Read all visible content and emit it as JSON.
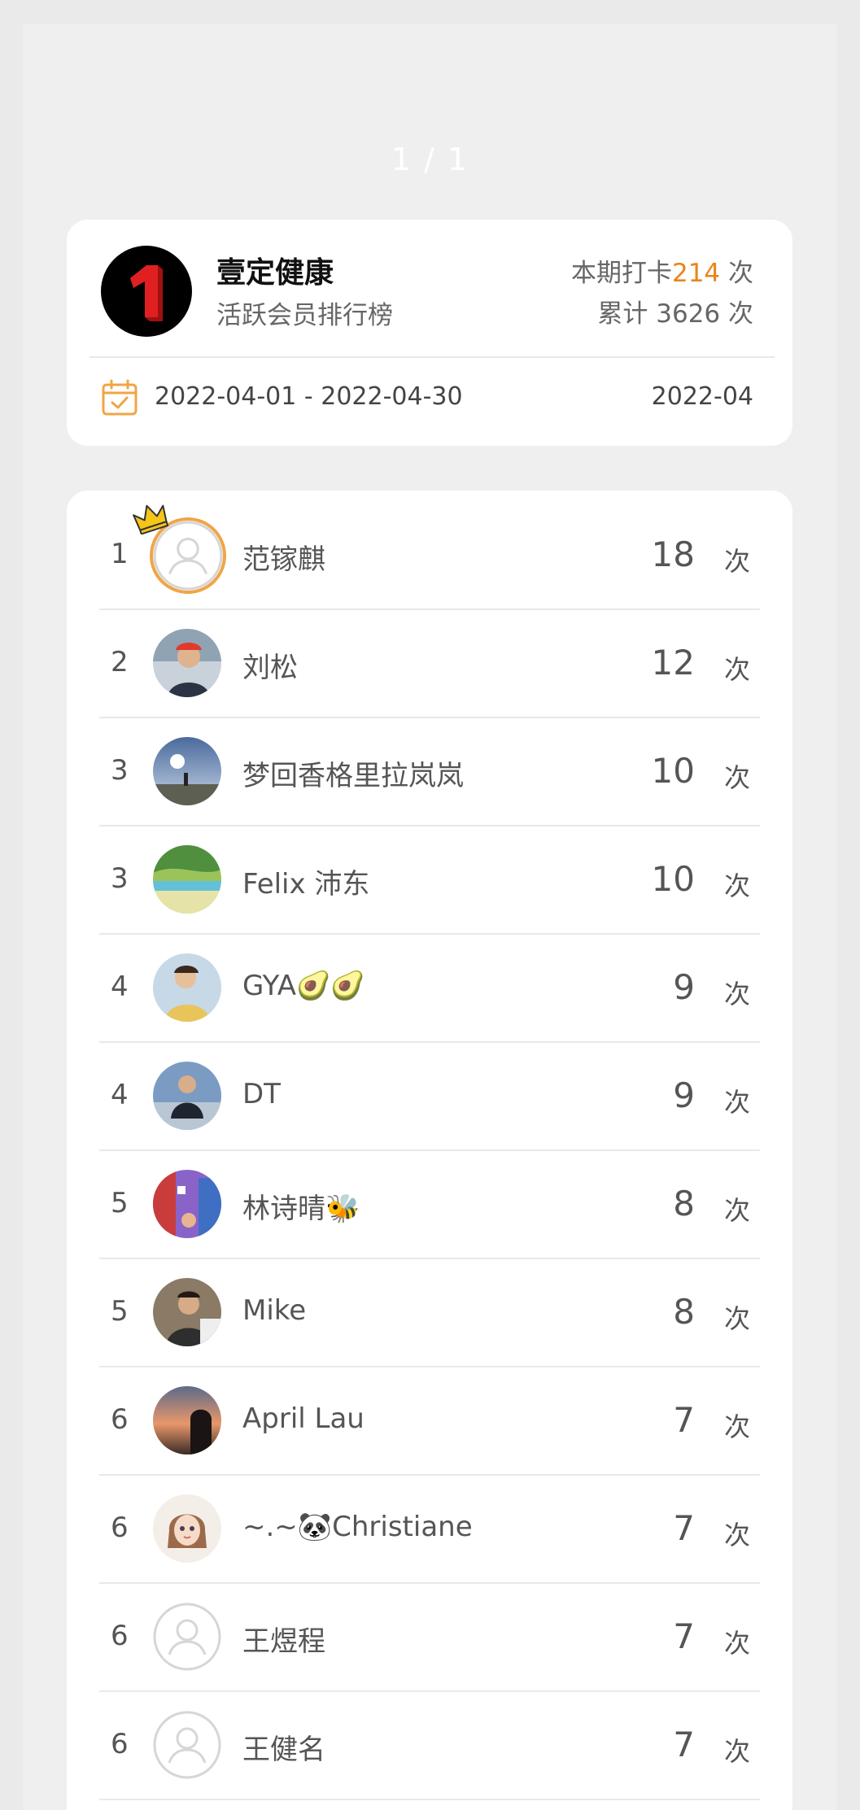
{
  "page_indicator": "1 / 1",
  "header": {
    "org_name": "壹定健康",
    "org_subtitle": "活跃会员排行榜",
    "period_checkins_label": "本期打卡",
    "period_checkins_value": "214",
    "period_checkins_unit": "次",
    "total_line": "累计 3626 次",
    "date_range": "2022-04-01 - 2022-04-30",
    "period": "2022-04",
    "accent_color": "#e8841a",
    "calendar_icon": "calendar-check-icon"
  },
  "unit": "次",
  "ranking": [
    {
      "rank": "1",
      "name": "范镓麒",
      "count": "18"
    },
    {
      "rank": "2",
      "name": "刘松",
      "count": "12"
    },
    {
      "rank": "3",
      "name": "梦回香格里拉岚岚",
      "count": "10"
    },
    {
      "rank": "3",
      "name": "Felix 沛东",
      "count": "10"
    },
    {
      "rank": "4",
      "name": "GYA🥑🥑",
      "count": "9"
    },
    {
      "rank": "4",
      "name": "DT",
      "count": "9"
    },
    {
      "rank": "5",
      "name": "林诗晴🐝",
      "count": "8"
    },
    {
      "rank": "5",
      "name": "Mike",
      "count": "8"
    },
    {
      "rank": "6",
      "name": "April Lau",
      "count": "7"
    },
    {
      "rank": "6",
      "name": "~.~🐼Christiane",
      "count": "7"
    },
    {
      "rank": "6",
      "name": "王煜程",
      "count": "7"
    },
    {
      "rank": "6",
      "name": "王健名",
      "count": "7"
    }
  ]
}
